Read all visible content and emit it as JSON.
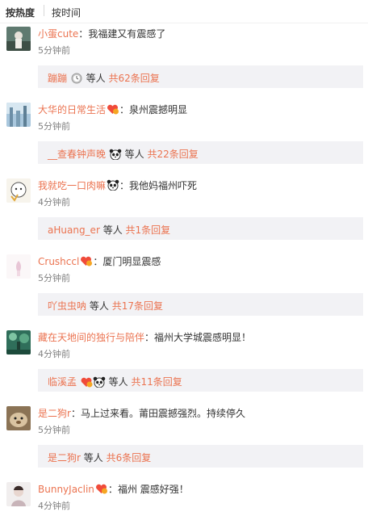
{
  "sort": {
    "hot": "按热度",
    "time": "按时间"
  },
  "comments": [
    {
      "user": "小蛋cute",
      "sep": "：",
      "text": "我福建又有震感了",
      "time": "5分钟前",
      "badge": false,
      "reply": {
        "users": "蹦蹦",
        "emoji": [
          "clock"
        ],
        "mid": "等人",
        "count": "共62条回复"
      }
    },
    {
      "user": "大华的日常生活",
      "sep": "：",
      "text": "泉州震撼明显",
      "time": "5分钟前",
      "badge": true,
      "reply": {
        "users": "__查春钟声晚",
        "emoji": [
          "panda"
        ],
        "mid": "等人",
        "count": "共22条回复"
      }
    },
    {
      "user": "我就吃一口肉嘛",
      "sep": "：",
      "text": "我他妈福州吓死",
      "time": "4分钟前",
      "badge": false,
      "badge_emoji": "panda",
      "reply": {
        "users": "aHuang_er",
        "emoji": [],
        "mid": "等人",
        "count": "共1条回复"
      }
    },
    {
      "user": "Crushccl",
      "sep": "：",
      "text": "厦门明显震感",
      "time": "5分钟前",
      "badge": true,
      "reply": {
        "users": "吖虫虫呐",
        "emoji": [],
        "mid": "等人",
        "count": "共17条回复"
      }
    },
    {
      "user": "藏在天地间的独行与陪伴",
      "sep": "：",
      "text": "福州大学城震感明显！",
      "time": "4分钟前",
      "badge": false,
      "reply": {
        "users": "临溪孟",
        "emoji": [
          "vip",
          "panda"
        ],
        "mid": "等人",
        "count": "共11条回复"
      }
    },
    {
      "user": "是二狗r",
      "sep": "：",
      "text": "马上过来看。莆田震撼强烈。持续停久",
      "time": "5分钟前",
      "badge": false,
      "reply": {
        "users": "是二狗r",
        "emoji": [],
        "mid": "等人",
        "count": "共6条回复"
      }
    },
    {
      "user": "BunnyJaclin",
      "sep": "：",
      "text": "福州 震感好强！",
      "time": "4分钟前",
      "badge": true,
      "reply": null
    }
  ]
}
